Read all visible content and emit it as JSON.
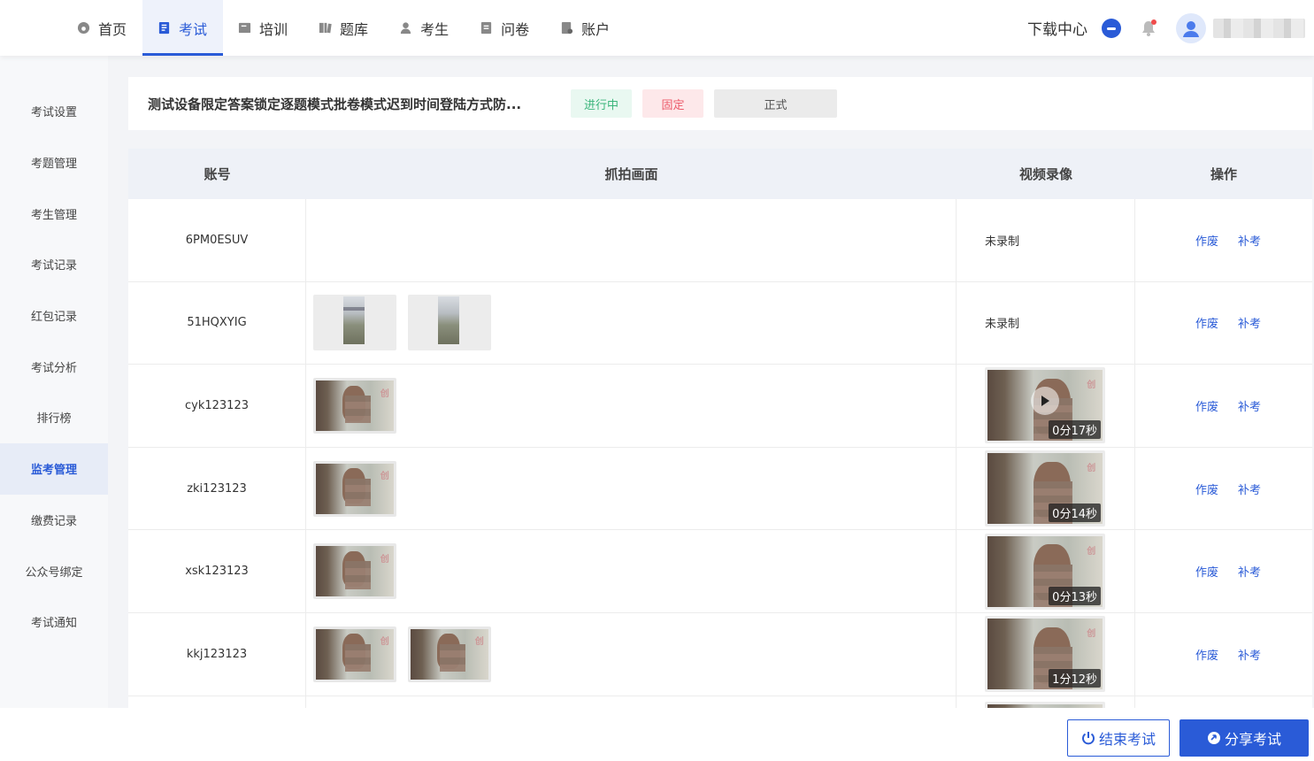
{
  "nav": {
    "items": [
      {
        "label": "首页",
        "icon": "home-icon"
      },
      {
        "label": "考试",
        "icon": "exam-icon",
        "active": true
      },
      {
        "label": "培训",
        "icon": "training-icon"
      },
      {
        "label": "题库",
        "icon": "question-bank-icon"
      },
      {
        "label": "考生",
        "icon": "examinee-icon"
      },
      {
        "label": "问卷",
        "icon": "survey-icon"
      },
      {
        "label": "账户",
        "icon": "account-icon"
      }
    ],
    "download_center": "下载中心"
  },
  "sidebar": {
    "items": [
      {
        "label": "考试设置"
      },
      {
        "label": "考题管理"
      },
      {
        "label": "考生管理"
      },
      {
        "label": "考试记录"
      },
      {
        "label": "红包记录"
      },
      {
        "label": "考试分析"
      },
      {
        "label": "排行榜"
      },
      {
        "label": "监考管理",
        "active": true
      },
      {
        "label": "缴费记录"
      },
      {
        "label": "公众号绑定"
      },
      {
        "label": "考试通知"
      }
    ]
  },
  "exam": {
    "title": "测试设备限定答案锁定逐题模式批卷模式迟到时间登陆方式防...",
    "status_tag": "进行中",
    "fixed_tag": "固定",
    "type_tag": "正式"
  },
  "table": {
    "headers": {
      "account": "账号",
      "snapshots": "抓拍画面",
      "video": "视频录像",
      "actions": "操作"
    },
    "action_void": "作废",
    "action_retake": "补考",
    "rows": [
      {
        "account": "6PM0ESUV",
        "snapshots": 0,
        "video": "未录制"
      },
      {
        "account": "51HQXYIG",
        "snapshots": 2,
        "video": "未录制"
      },
      {
        "account": "cyk123123",
        "snapshots": 1,
        "video_duration": "0分17秒"
      },
      {
        "account": "zki123123",
        "snapshots": 1,
        "video_duration": "0分14秒"
      },
      {
        "account": "xsk123123",
        "snapshots": 1,
        "video_duration": "0分13秒"
      },
      {
        "account": "kkj123123",
        "snapshots": 2,
        "video_duration": "1分12秒"
      }
    ]
  },
  "buttons": {
    "end_exam": "结束考试",
    "share_exam": "分享考试"
  },
  "colors": {
    "primary": "#2a5bd7",
    "status_green": "#3bb57b",
    "status_red": "#ec5a6a"
  }
}
